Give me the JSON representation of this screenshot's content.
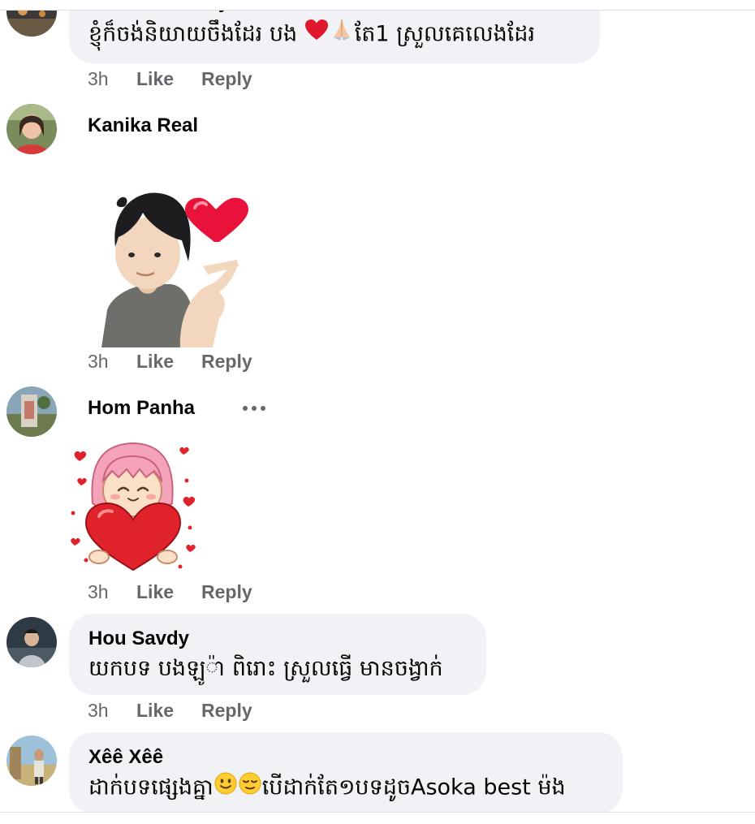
{
  "comments": [
    {
      "author": "Doem Khankey",
      "text_a": "ខ្ញុំក៏ចង់និយាយចឹងដែរ បង ",
      "text_b": "តែ1 ស្រួលគេលេងដែរ",
      "time": "3h",
      "like": "Like",
      "reply": "Reply"
    },
    {
      "author": "Kanika Real",
      "sticker": "heart-finger-boy-sticker",
      "time": "3h",
      "like": "Like",
      "reply": "Reply"
    },
    {
      "author": "Hom Panha",
      "sticker": "girl-hugging-heart-sticker",
      "more_icon": "more-horizontal-icon",
      "time": "3h",
      "like": "Like",
      "reply": "Reply"
    },
    {
      "author": "Hou Savdy",
      "text": "យកបទ បងឡូ៉ា ពិរោះ ស្រួលធ្វើ មានចង្វាក់",
      "time": "3h",
      "like": "Like",
      "reply": "Reply"
    },
    {
      "author": "Xêê Xêê",
      "text_a": "ដាក់បទផ្សេងគ្នា",
      "text_b": "បើដាក់តែ១បទដូចAsoka best ម៉ង"
    }
  ],
  "colors": {
    "bubble": "#f0f2f5",
    "meta": "#65676b",
    "text": "#050505",
    "heart": "#e0245e"
  }
}
